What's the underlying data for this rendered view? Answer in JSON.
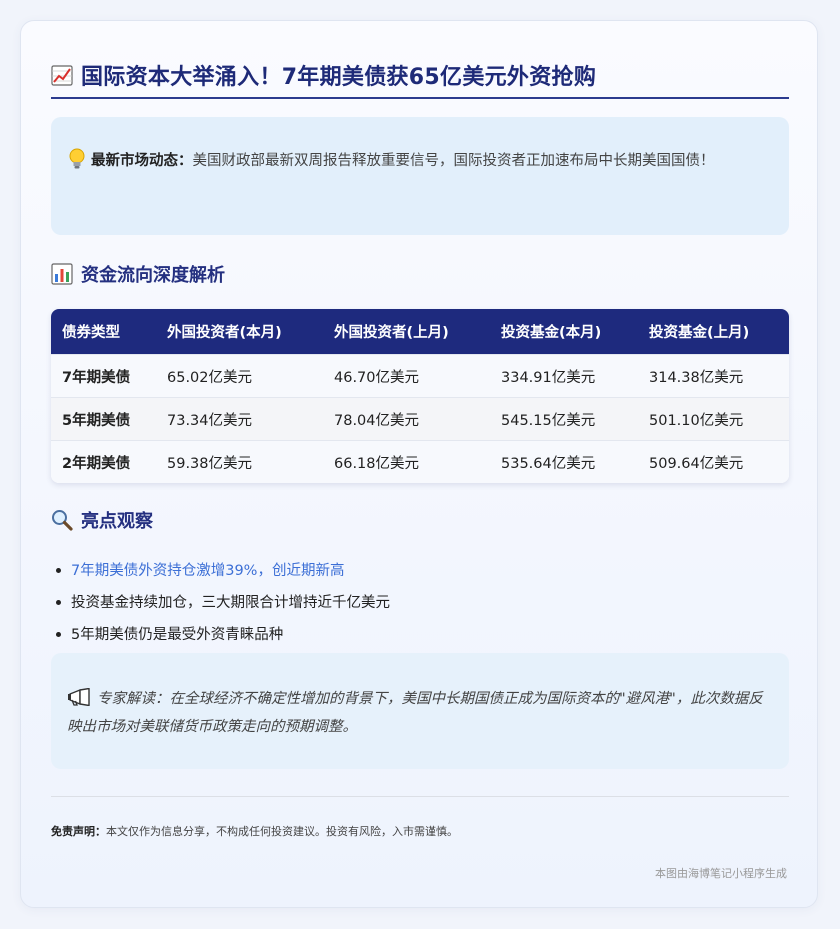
{
  "title": "国际资本大举涌入！7年期美债获65亿美元外资抢购",
  "market_note": {
    "label": "最新市场动态：",
    "text": "美国财政部最新双周报告释放重要信号，国际投资者正加速布局中长期美国国债！"
  },
  "flow_section": {
    "title": "资金流向深度解析"
  },
  "table": {
    "headers": [
      "债券类型",
      "外国投资者(本月)",
      "外国投资者(上月)",
      "投资基金(本月)",
      "投资基金(上月)"
    ],
    "rows": [
      [
        "7年期美债",
        "65.02亿美元",
        "46.70亿美元",
        "334.91亿美元",
        "314.38亿美元"
      ],
      [
        "5年期美债",
        "73.34亿美元",
        "78.04亿美元",
        "545.15亿美元",
        "501.10亿美元"
      ],
      [
        "2年期美债",
        "59.38亿美元",
        "66.18亿美元",
        "535.64亿美元",
        "509.64亿美元"
      ]
    ]
  },
  "highlights_section": {
    "title": "亮点观察"
  },
  "highlights": [
    "7年期美债外资持仓激增39%，创近期新高",
    "投资基金持续加仓，三大期限合计增持近千亿美元",
    "5年期美债仍是最受外资青睐品种"
  ],
  "expert": {
    "text": "专家解读：在全球经济不确定性增加的背景下，美国中长期国债正成为国际资本的\"避风港\"，此次数据反映出市场对美联储货币政策走向的预期调整。"
  },
  "disclaimer": {
    "label": "免责声明：",
    "text": "本文仅作为信息分享，不构成任何投资建议。投资有风险，入市需谨慎。"
  },
  "footer": "本图由海博笔记小程序生成",
  "colors": {
    "primary": "#1e2a7e",
    "accent": "#3c6fd6",
    "note_bg": "#e2effb"
  },
  "icons": [
    "chart-up-icon",
    "lightbulb-icon",
    "bar-chart-icon",
    "magnifier-icon",
    "megaphone-icon"
  ]
}
